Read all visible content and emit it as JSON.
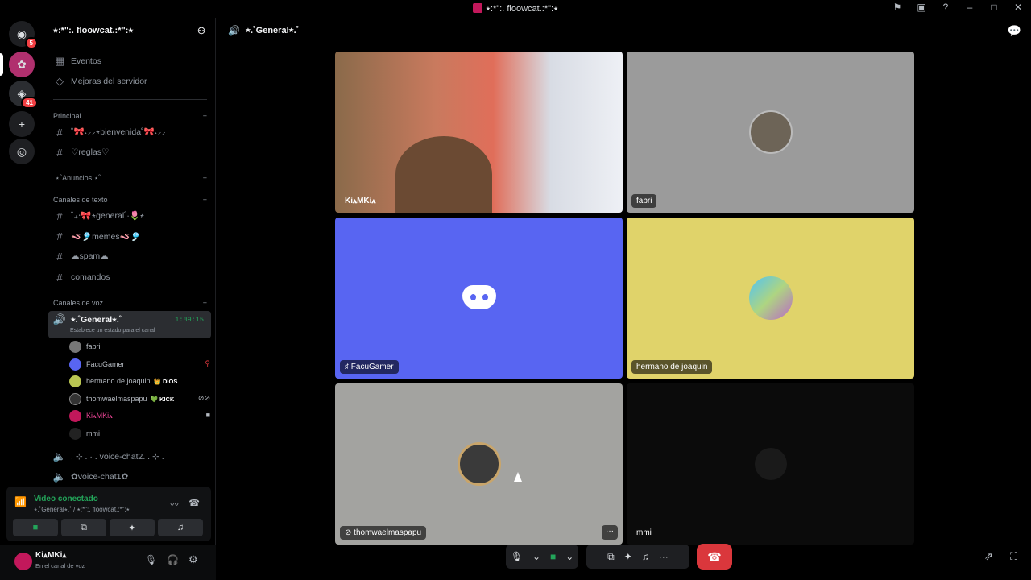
{
  "window": {
    "title": "⭑:*\":. floowcat.:*\":⭑"
  },
  "servers": {
    "dm_badge": "5",
    "server2_badge": "41"
  },
  "sidebar": {
    "server_name": "⭑:*\":. floowcat.:*\":⭑",
    "events": "Eventos",
    "boosts": "Mejoras del servidor",
    "cat_principal": "Principal",
    "ch_bienvenida": "˚🎀˖⸝⸝⭒bienvenida˚🎀˖⸝⸝",
    "ch_reglas": "♡reglas♡",
    "cat_anuncios": ".⋆˚Anuncios.⋆˚",
    "cat_texto": "Canales de texto",
    "ch_general_text": "˚₊‧🎀⭒general˚‧🌷⭒",
    "ch_memes": "🪱🎐memes🪱🎐",
    "ch_spam": "☁spam☁",
    "ch_comandos": "comandos",
    "cat_voz": "Canales de voz",
    "voice_active": "⭒.˚General⭒.˚",
    "voice_timer": "1:09:15",
    "voice_status": "Establece un estado para el canal",
    "voice_users": [
      {
        "name": "fabri",
        "tag": ""
      },
      {
        "name": "FacuGamer",
        "tag": ""
      },
      {
        "name": "hermano de joaquin",
        "tag": "👑 DIOS"
      },
      {
        "name": "thomwaelmaspapu",
        "tag": "💚 KICK"
      },
      {
        "name": "KiꭺMKiꭺ",
        "tag": ""
      },
      {
        "name": "mmi",
        "tag": ""
      }
    ],
    "voice_ch2": ". ⊹ . · . voice-chat2. . ⊹ .",
    "voice_ch1": "✿voice-chat1✿"
  },
  "voice_panel": {
    "title": "Video conectado",
    "subtitle": "⭒.˚General⭒.˚ / ⭑:*\":. floowcat.:*\":⭑"
  },
  "user_panel": {
    "name": "KiꭺMKiꭺ",
    "status": "En el canal de voz"
  },
  "header": {
    "channel": "⭒.˚General⭒.˚"
  },
  "tiles": [
    {
      "name": "KiꭺMKiꭺ",
      "bg": "#c97a5e"
    },
    {
      "name": "fabri",
      "bg": "#9b9b9b"
    },
    {
      "name": "FacuGamer",
      "bg": "#5865f2"
    },
    {
      "name": "hermano de joaquin",
      "bg": "#e0d36a"
    },
    {
      "name": "thomwaelmaspapu",
      "bg": "#a3a3a0"
    },
    {
      "name": "mmi",
      "bg": "#0b0b0b"
    }
  ],
  "colors": {
    "accent": "#5865f2",
    "green": "#23a55a",
    "danger": "#da373c"
  }
}
